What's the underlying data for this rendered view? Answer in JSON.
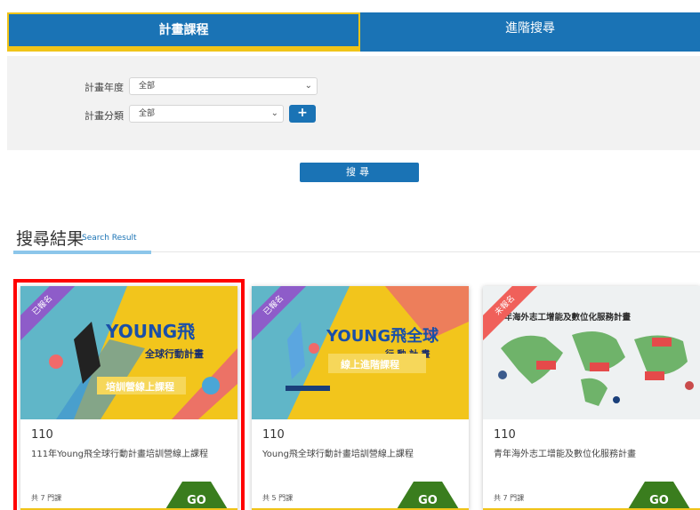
{
  "tabs": [
    {
      "label": "計畫課程",
      "active": true
    },
    {
      "label": "進階搜尋",
      "active": false
    }
  ],
  "form": {
    "year_label": "計畫年度",
    "year_value": "全部",
    "category_label": "計畫分類",
    "category_value": "全部",
    "plus_label": "+",
    "search_label": "搜尋"
  },
  "results": {
    "title": "搜尋結果",
    "subtitle": "Search Result"
  },
  "cards": [
    {
      "badge": "已報名",
      "badge_color": "#8e5cc9",
      "image_title_line1": "YOUNG飛",
      "image_title_line2": "全球行動計畫",
      "image_banner": "培訓營線上課程",
      "year": "110",
      "title": "111年Young飛全球行動計畫培訓營線上課程",
      "count": "共 7 門課",
      "go": "GO"
    },
    {
      "badge": "已報名",
      "badge_color": "#8e5cc9",
      "image_title_line1": "YOUNG飛全球",
      "image_title_line2": "行 動 計 畫",
      "image_banner": "線上進階課程",
      "year": "110",
      "title": "Young飛全球行動計畫培訓營線上課程",
      "count": "共 5 門課",
      "go": "GO"
    },
    {
      "badge": "未報名",
      "badge_color": "#f0605a",
      "image_title_line1": "青年海外志工增能及數位化服務計畫",
      "year": "110",
      "title": "青年海外志工增能及數位化服務計畫",
      "count": "共 7 門課",
      "go": "GO"
    }
  ]
}
